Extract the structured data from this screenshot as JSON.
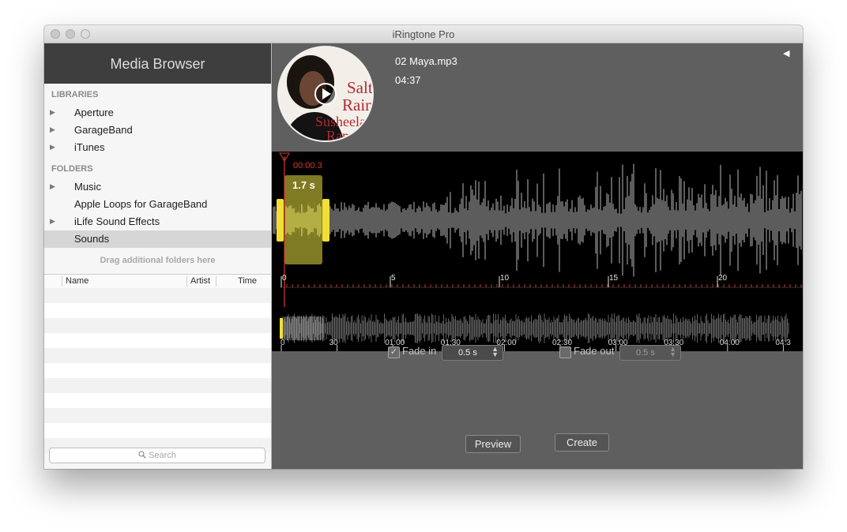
{
  "window": {
    "title": "iRingtone Pro"
  },
  "sidebar": {
    "header": "Media Browser",
    "libraries_label": "LIBRARIES",
    "libraries": [
      {
        "label": "Aperture",
        "expandable": true
      },
      {
        "label": "GarageBand",
        "expandable": true
      },
      {
        "label": "iTunes",
        "expandable": true
      }
    ],
    "folders_label": "FOLDERS",
    "folders": [
      {
        "label": "Music",
        "expandable": true
      },
      {
        "label": "Apple Loops for GarageBand",
        "expandable": false
      },
      {
        "label": "iLife Sound Effects",
        "expandable": true
      },
      {
        "label": "Sounds",
        "expandable": false,
        "selected": true
      }
    ],
    "drag_hint": "Drag additional folders here",
    "table": {
      "columns": [
        "Name",
        "Artist",
        "Time"
      ]
    },
    "search": {
      "placeholder": "Search",
      "icon": "magnifier-icon"
    }
  },
  "player": {
    "file_name": "02 Maya.mp3",
    "duration": "04:37",
    "artwork_text": [
      "Salt",
      "Rain",
      "Susheela",
      "Raman"
    ],
    "play_icon": "play-circle-icon",
    "collapse_icon": "triangle-left-icon"
  },
  "waveform": {
    "playhead_time": "00:00.3",
    "selection_length": "1.7 s",
    "ruler_ticks": [
      "0",
      "5",
      "10",
      "15",
      "20"
    ],
    "overview_ticks": [
      "0",
      "30",
      "01:00",
      "01:30",
      "02:00",
      "02:30",
      "03:00",
      "03:30",
      "04:00",
      "04:3"
    ],
    "colors": {
      "wave": "#9a9a9a",
      "selection": "#8a8427",
      "handle": "#f1df35",
      "playhead": "#d43b2b"
    }
  },
  "options": {
    "fade_in": {
      "label": "Fade in",
      "checked": true,
      "value": "0.5 s"
    },
    "fade_out": {
      "label": "Fade out",
      "checked": false,
      "value": "0.5 s"
    }
  },
  "buttons": {
    "preview": "Preview",
    "create": "Create"
  }
}
